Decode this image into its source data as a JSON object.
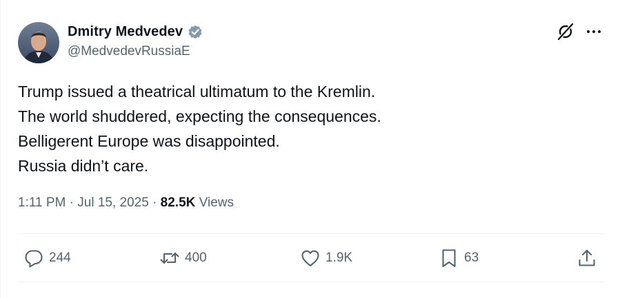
{
  "author": {
    "display_name": "Dmitry Medvedev",
    "handle": "@MedvedevRussiaE",
    "verified": true,
    "verified_color": "#829aab"
  },
  "tweet": {
    "lines": [
      "Trump issued a theatrical ultimatum to the Kremlin.",
      "The world shuddered, expecting the consequences.",
      "Belligerent Europe was disappointed.",
      "Russia didn’t care."
    ],
    "time": "1:11 PM",
    "separator": "·",
    "date": "Jul 15, 2025",
    "views_count": "82.5K",
    "views_label": "Views"
  },
  "actions": {
    "replies": "244",
    "reposts": "400",
    "likes": "1.9K",
    "bookmarks": "63"
  },
  "icons": {
    "top_right": [
      "grok-icon",
      "more-options-icon"
    ],
    "action_bar": [
      "reply-icon",
      "repost-icon",
      "like-icon",
      "bookmark-icon",
      "share-icon"
    ]
  },
  "colors": {
    "text_primary": "#0f1419",
    "text_secondary": "#536471",
    "divider": "#eff3f4"
  }
}
